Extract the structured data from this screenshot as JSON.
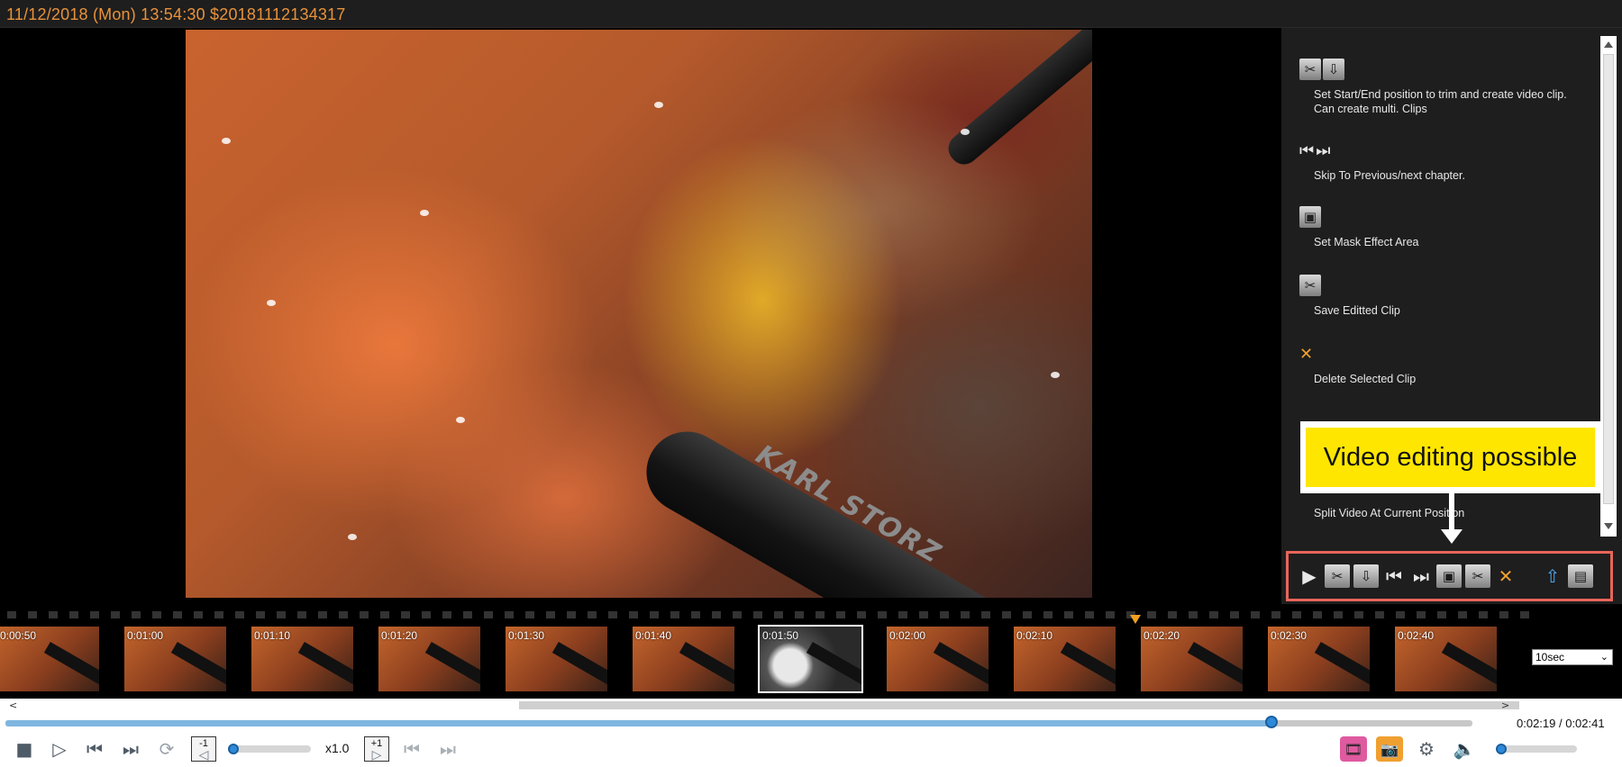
{
  "titlebar": {
    "title": "11/12/2018 (Mon) 13:54:30   $20181112134317"
  },
  "video": {
    "instrument_label": "KARL STORZ"
  },
  "help": {
    "items": [
      {
        "icon": "clip-start-end-icon",
        "text": "Set Start/End position to trim and create video clip.\nCan create multi. Clips"
      },
      {
        "icon": "chapter-skip-icon",
        "text": "Skip To Previous/next chapter."
      },
      {
        "icon": "mask-effect-icon",
        "text": "Set Mask Effect Area"
      },
      {
        "icon": "scissors-icon",
        "text": "Save Editted Clip"
      },
      {
        "icon": "delete-clip-icon",
        "text": "Delete Selected Clip"
      },
      {
        "icon": "split-video-icon",
        "text": "Split Video At Current Position"
      }
    ]
  },
  "callout": {
    "text": "Video editing possible",
    "background": "#ffe600"
  },
  "edit_toolbar": {
    "border_color": "#e8655a",
    "buttons": [
      "play-icon",
      "clip-start-icon",
      "clip-end-icon",
      "previous-chapter-icon",
      "next-chapter-icon",
      "mask-effect-icon",
      "scissors-icon",
      "delete-clip-icon",
      "export-icon",
      "split-video-icon"
    ]
  },
  "filmstrip": {
    "thumbnails": [
      {
        "time": "0:00:50"
      },
      {
        "time": "0:01:00"
      },
      {
        "time": "0:01:10"
      },
      {
        "time": "0:01:20"
      },
      {
        "time": "0:01:30"
      },
      {
        "time": "0:01:40"
      },
      {
        "time": "0:01:50"
      },
      {
        "time": "0:02:00"
      },
      {
        "time": "0:02:10"
      },
      {
        "time": "0:02:20"
      },
      {
        "time": "0:02:30"
      },
      {
        "time": "0:02:40"
      }
    ],
    "selected_index": 6,
    "interval": "10sec",
    "marker_color": "#f0a020"
  },
  "playback": {
    "time_readout": "0:02:19 / 0:02:41",
    "progress_fraction": 0.863,
    "speed": "x1.0",
    "step_back_label": "-1",
    "step_forward_label": "+1",
    "speed_slider_fraction": 0.0,
    "volume_fraction": 0.0
  },
  "colors": {
    "title_text": "#e8923a",
    "panel_bg": "#1e1e1e",
    "seek_thumb": "#2e8ad8",
    "record_button": "#e05aa0",
    "snapshot_button": "#f0a030"
  }
}
